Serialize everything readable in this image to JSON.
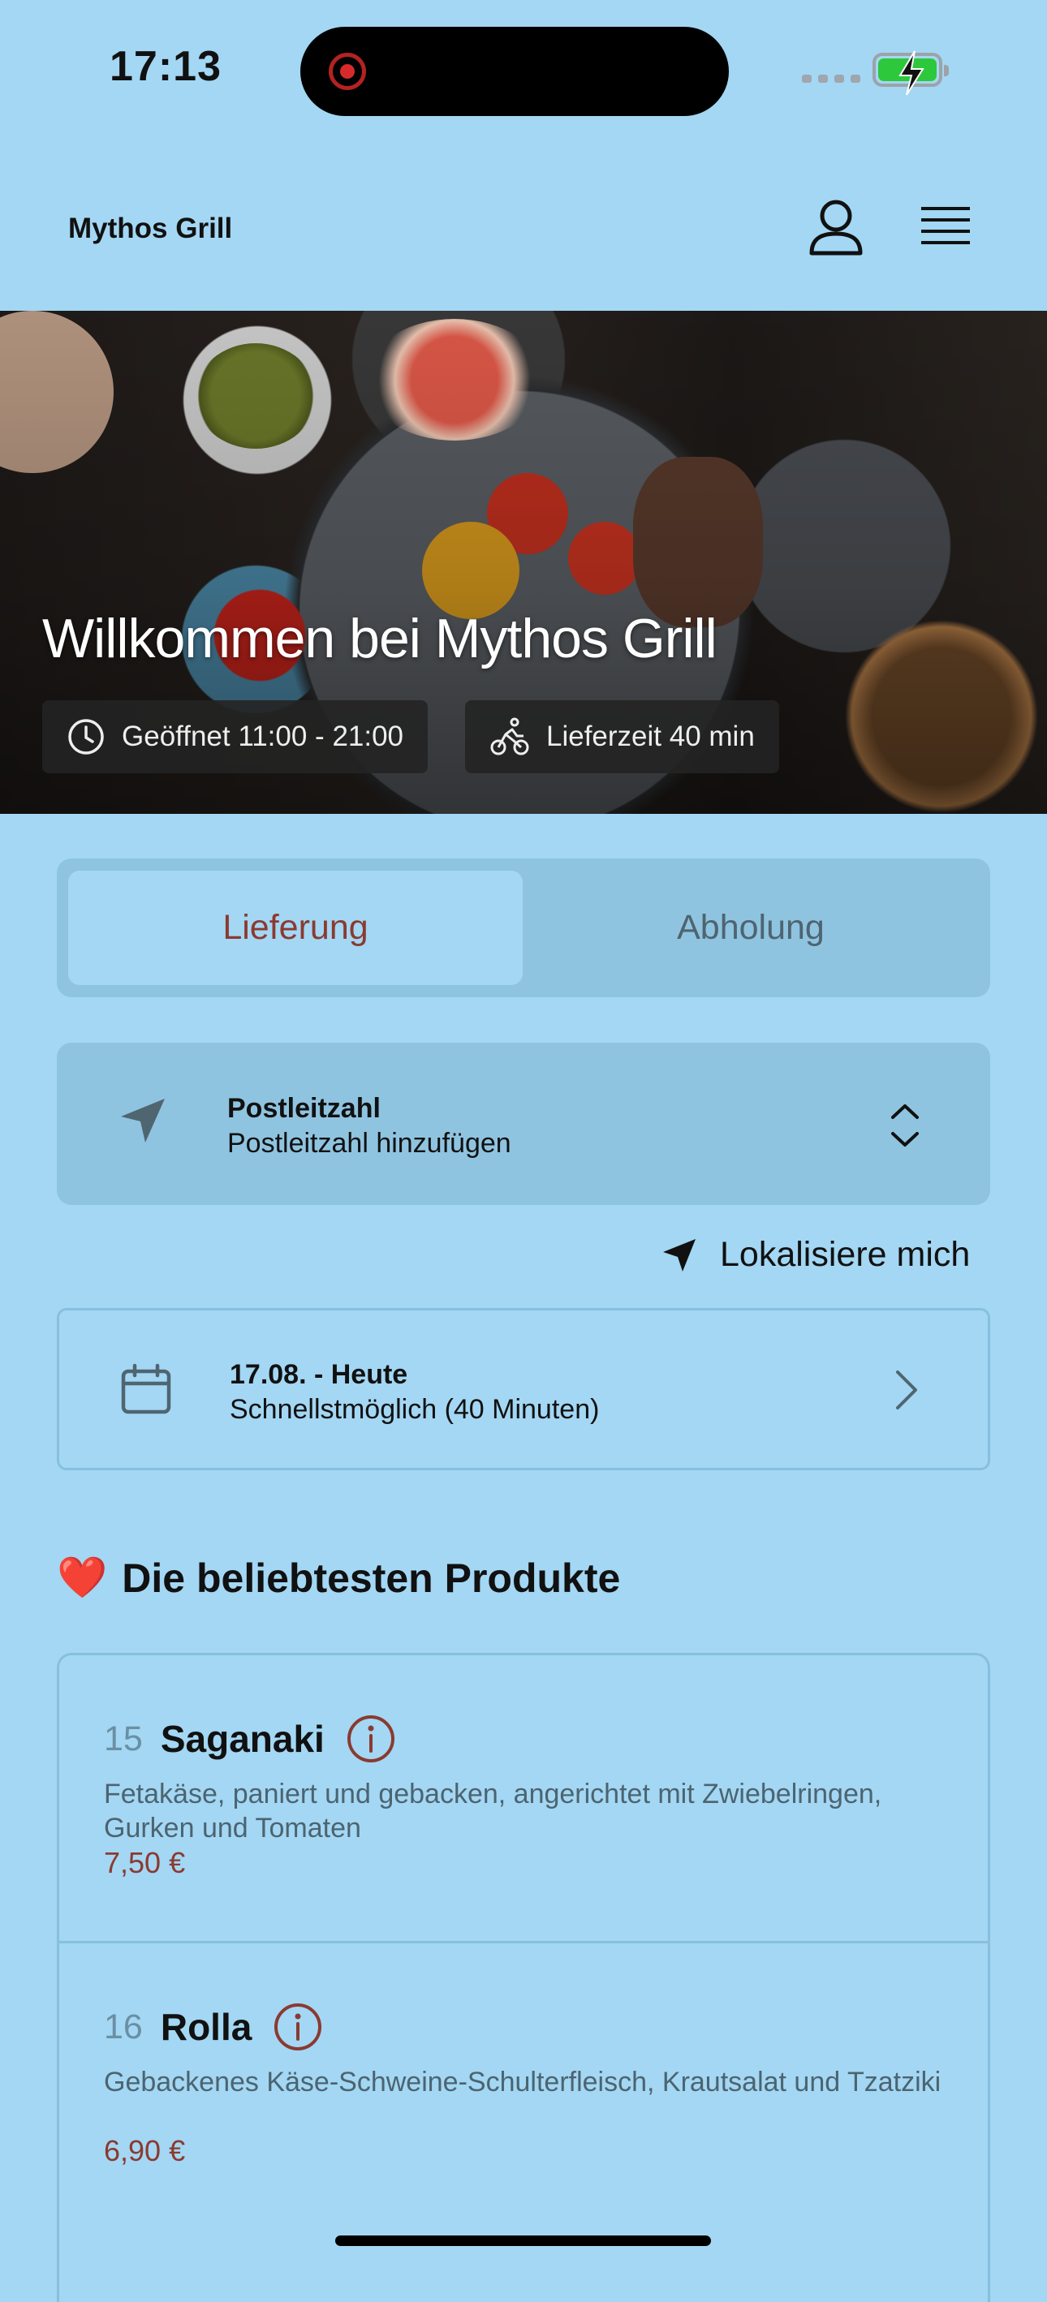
{
  "status_bar": {
    "time": "17:13"
  },
  "header": {
    "title": "Mythos Grill"
  },
  "hero": {
    "title": "Willkommen bei Mythos Grill",
    "open_hours": "Geöffnet 11:00 - 21:00",
    "delivery_time": "Lieferzeit 40 min"
  },
  "mode_tabs": {
    "delivery": "Lieferung",
    "pickup": "Abholung",
    "active": "delivery"
  },
  "postcode": {
    "label": "Postleitzahl",
    "placeholder": "Postleitzahl hinzufügen"
  },
  "locate": {
    "label": "Lokalisiere mich"
  },
  "schedule": {
    "title": "17.08. - Heute",
    "subtitle": "Schnellstmöglich (40 Minuten)"
  },
  "popular": {
    "emoji": "❤️",
    "title": "Die beliebtesten Produkte",
    "products": [
      {
        "number": "15",
        "name": "Saganaki",
        "description": "Fetakäse, paniert und gebacken, angerichtet mit Zwiebelringen, Gurken und Tomaten",
        "price": "7,50 €"
      },
      {
        "number": "16",
        "name": "Rolla",
        "description": "Gebackenes Käse-Schweine-Schulterfleisch, Krautsalat und Tzatziki",
        "price": "6,90 €"
      }
    ]
  },
  "colors": {
    "background": "#a3d7f4",
    "panel": "#8fc4e0",
    "accent": "#8b3a30"
  }
}
